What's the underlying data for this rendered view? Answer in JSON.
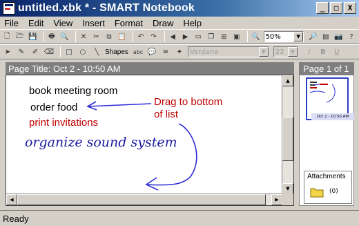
{
  "window": {
    "title": "untitled.xbk * - SMART Notebook",
    "buttons": {
      "minimize": "_",
      "maximize": "□",
      "close": "X"
    }
  },
  "menu": [
    "File",
    "Edit",
    "View",
    "Insert",
    "Format",
    "Draw",
    "Help"
  ],
  "toolbar": {
    "zoom": "50%",
    "shapes_label": "Shapes",
    "font_name": "Verdana",
    "font_size": "22"
  },
  "page": {
    "title": "Page Title: Oct 2 - 10:50 AM",
    "notes": [
      {
        "text": "book meeting room",
        "color": "#000000"
      },
      {
        "text": "order food",
        "color": "#000000"
      },
      {
        "text": "print invitations",
        "color": "#c00000"
      }
    ],
    "annotation": "Drag to bottom of list",
    "annotation_lines": [
      "Drag to bottom",
      "of list"
    ],
    "handwriting": "organize sound system"
  },
  "sidebar": {
    "header": "Page 1 of 1",
    "thumbnail_label": "Oct 2 - 10:50 AM",
    "attachments_title": "Attachments",
    "attachments_count": "(0)"
  },
  "status": {
    "text": "Ready"
  }
}
